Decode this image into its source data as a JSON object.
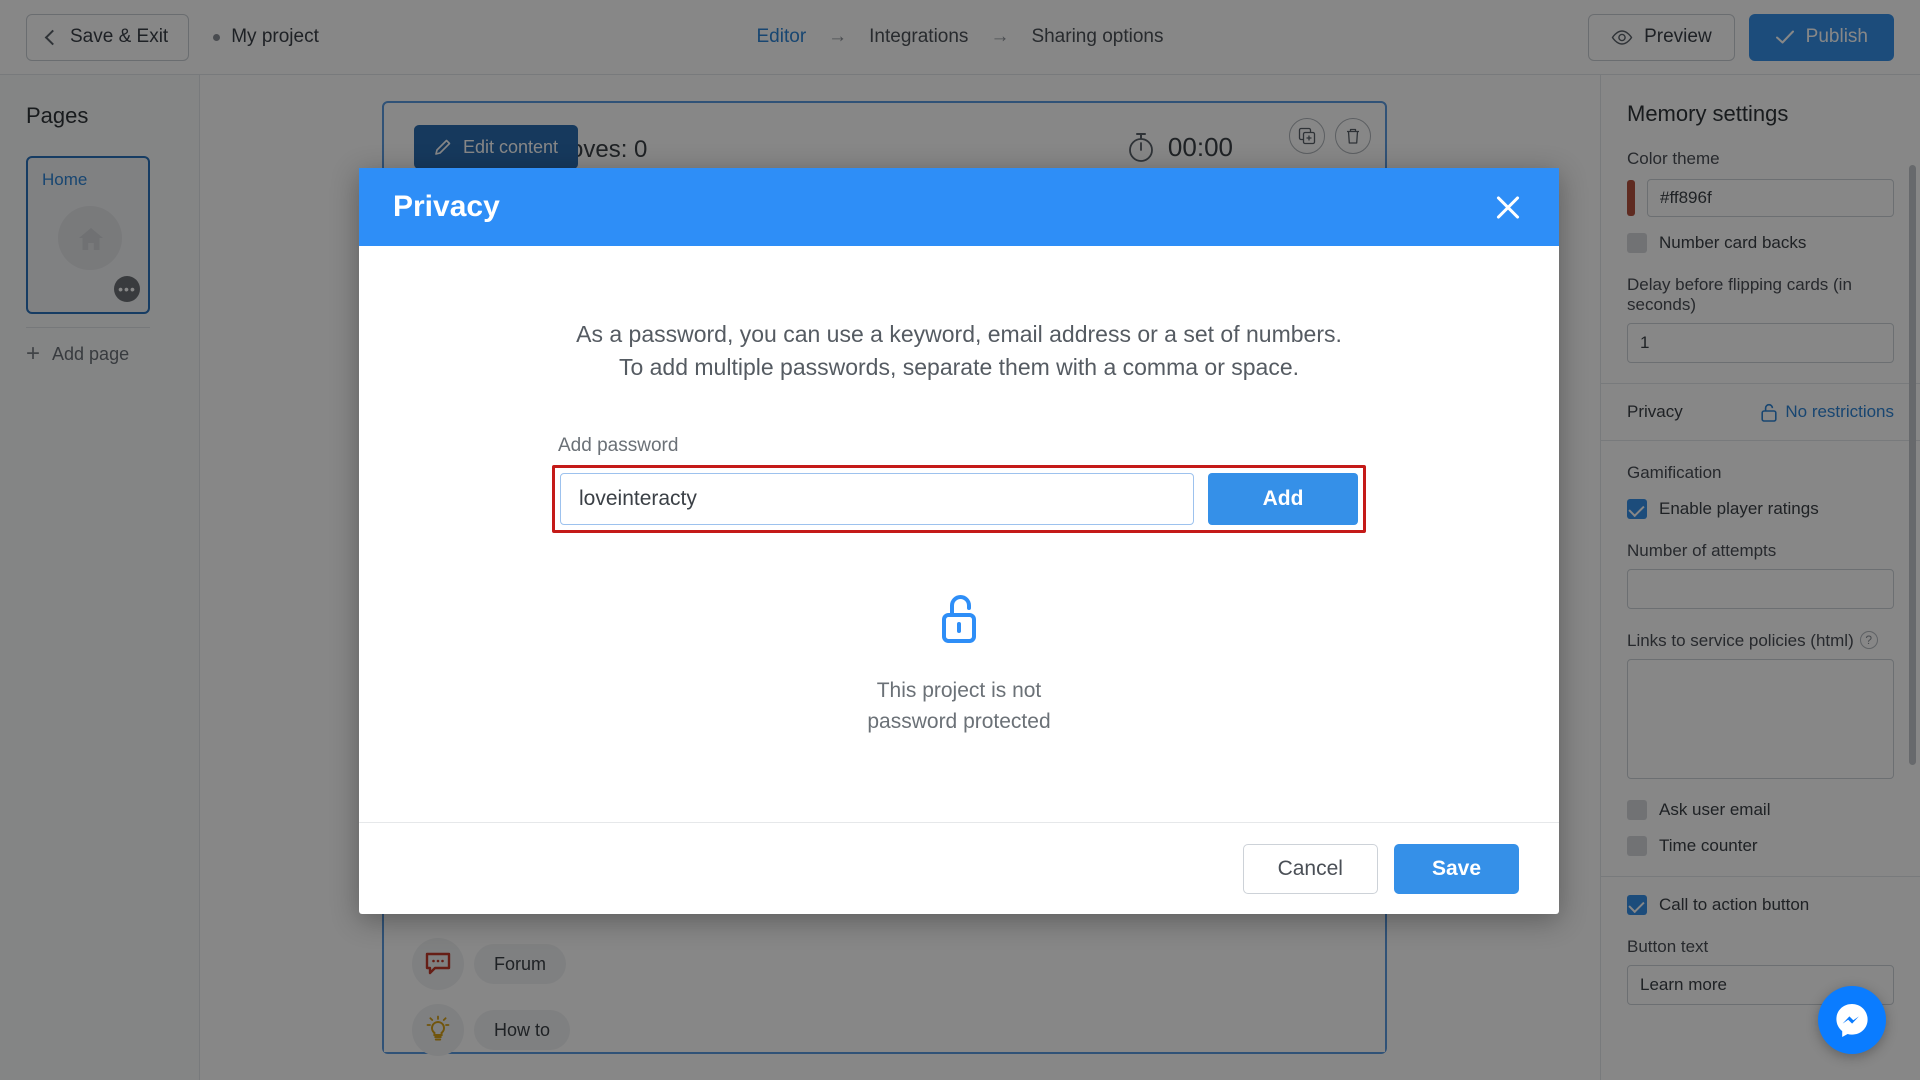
{
  "topbar": {
    "save_exit_label": "Save & Exit",
    "project_name": "My project",
    "breadcrumb": [
      {
        "label": "Editor",
        "active": true
      },
      {
        "label": "Integrations",
        "active": false
      },
      {
        "label": "Sharing options",
        "active": false
      }
    ],
    "arrow_glyph": "→",
    "preview_label": "Preview",
    "publish_label": "Publish"
  },
  "left_panel": {
    "title": "Pages",
    "page_card": {
      "label": "Home",
      "more_glyph": "•••"
    },
    "add_page_label": "Add page",
    "plus_glyph": "+"
  },
  "canvas": {
    "edit_content_label": "Edit content",
    "moves_label": "Moves: 0",
    "timer_value": "00:00",
    "help_buttons": [
      {
        "label": "Forum",
        "icon": "chat-bubble-icon"
      },
      {
        "label": "How to",
        "icon": "lightbulb-icon"
      }
    ]
  },
  "right_panel": {
    "title": "Memory settings",
    "color_theme_label": "Color theme",
    "color_theme_value": "#ff896f",
    "color_theme_swatch": "#b4513f",
    "number_card_backs_label": "Number card backs",
    "number_card_backs_checked": false,
    "delay_label": "Delay before flipping cards (in seconds)",
    "delay_value": "1",
    "privacy_label": "Privacy",
    "privacy_value": "No restrictions",
    "gamification_label": "Gamification",
    "enable_ratings_label": "Enable player ratings",
    "enable_ratings_checked": true,
    "attempts_label": "Number of attempts",
    "attempts_value": "",
    "links_label": "Links to service policies (html)",
    "links_value": "",
    "ask_email_label": "Ask user email",
    "ask_email_checked": false,
    "time_counter_label": "Time counter",
    "time_counter_checked": false,
    "cta_label": "Call to action button",
    "cta_checked": true,
    "button_text_label": "Button text",
    "button_text_value": "Learn more"
  },
  "modal": {
    "title": "Privacy",
    "description_line1": "As a password, you can use a keyword, email address or a set of numbers.",
    "description_line2": "To add multiple passwords, separate them with a comma or space.",
    "password_label": "Add password",
    "password_value": "loveinteracty",
    "password_placeholder": "",
    "add_label": "Add",
    "status_line1": "This project is not",
    "status_line2": "password protected",
    "cancel_label": "Cancel",
    "save_label": "Save"
  },
  "colors": {
    "accent_blue": "#3590e8",
    "modal_header_blue": "#2e8ef7",
    "highlight_red": "#c41a18",
    "messenger_blue": "#0a7cff"
  }
}
